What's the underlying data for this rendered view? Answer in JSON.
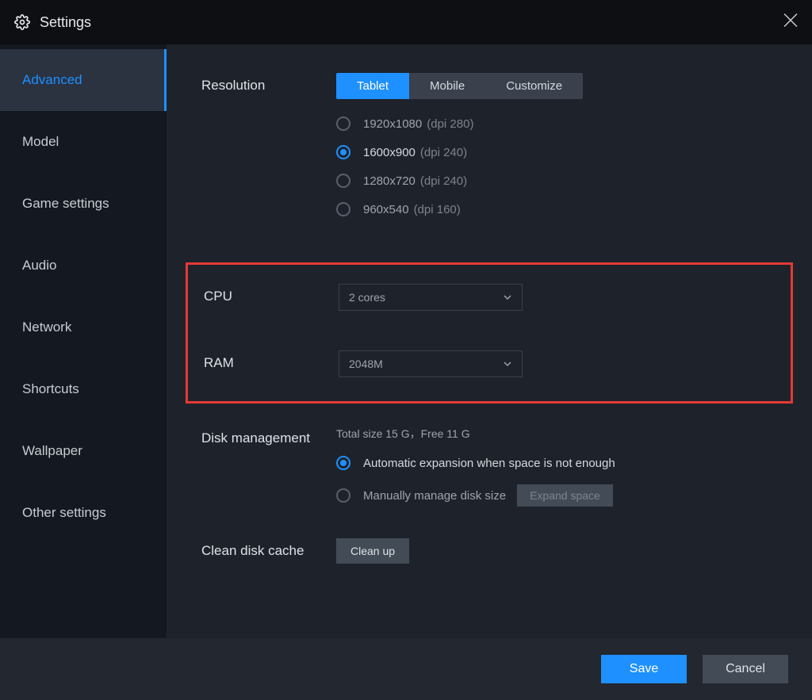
{
  "window": {
    "title": "Settings"
  },
  "sidebar": {
    "items": [
      {
        "label": "Advanced",
        "active": true
      },
      {
        "label": "Model"
      },
      {
        "label": "Game settings"
      },
      {
        "label": "Audio"
      },
      {
        "label": "Network"
      },
      {
        "label": "Shortcuts"
      },
      {
        "label": "Wallpaper"
      },
      {
        "label": "Other settings"
      }
    ]
  },
  "resolution": {
    "label": "Resolution",
    "tabs": [
      {
        "label": "Tablet",
        "active": true
      },
      {
        "label": "Mobile"
      },
      {
        "label": "Customize"
      }
    ],
    "options": [
      {
        "size": "1920x1080",
        "dpi": "(dpi 280)",
        "selected": false
      },
      {
        "size": "1600x900",
        "dpi": "(dpi 240)",
        "selected": true
      },
      {
        "size": "1280x720",
        "dpi": "(dpi 240)",
        "selected": false
      },
      {
        "size": "960x540",
        "dpi": "(dpi 160)",
        "selected": false
      }
    ]
  },
  "cpu": {
    "label": "CPU",
    "value": "2 cores"
  },
  "ram": {
    "label": "RAM",
    "value": "2048M"
  },
  "disk": {
    "label": "Disk management",
    "status": "Total size 15 G，Free 11 G",
    "options": [
      {
        "label": "Automatic expansion when space is not enough",
        "selected": true
      },
      {
        "label": "Manually manage disk size",
        "selected": false
      }
    ],
    "expand_button": "Expand space"
  },
  "cache": {
    "label": "Clean disk cache",
    "button": "Clean up"
  },
  "footer": {
    "save": "Save",
    "cancel": "Cancel"
  }
}
